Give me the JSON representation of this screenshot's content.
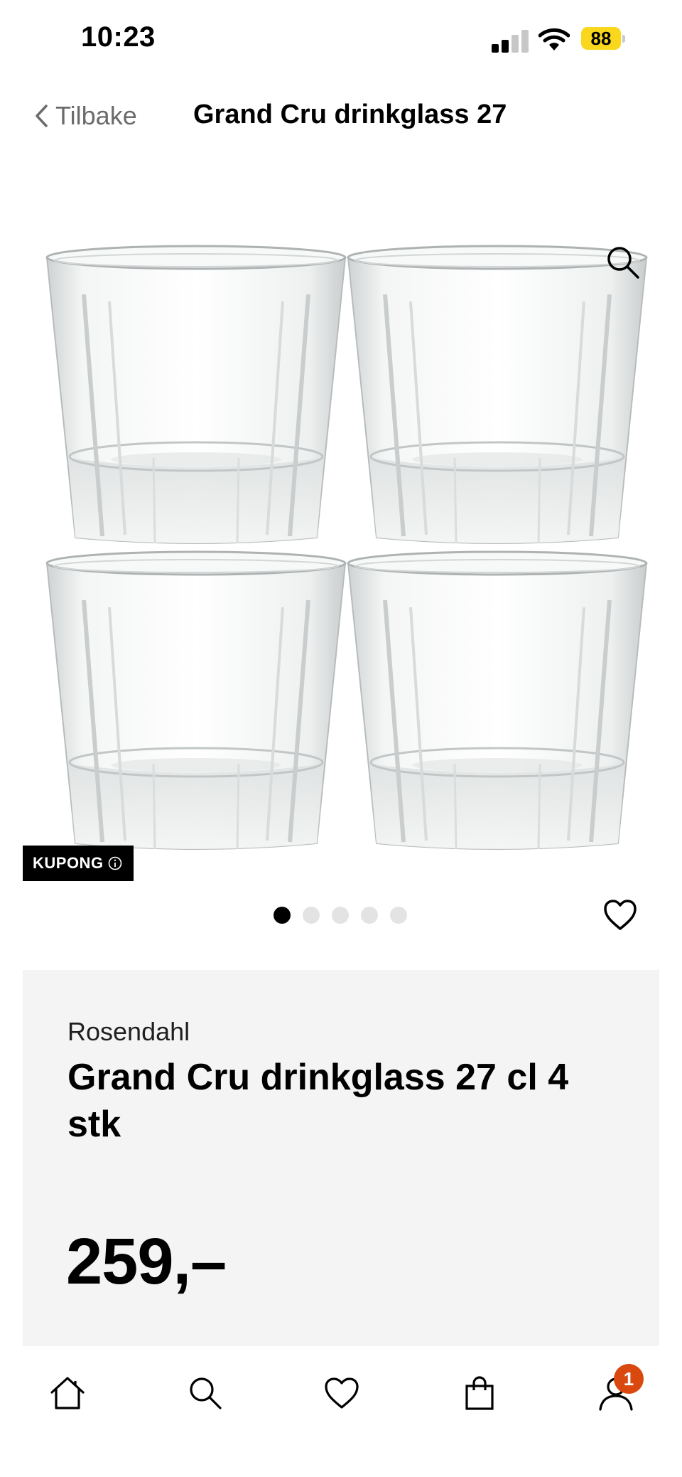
{
  "status_bar": {
    "time": "10:23",
    "battery": "88"
  },
  "nav": {
    "back_label": "Tilbake",
    "title": "Grand Cru drinkglass 27"
  },
  "gallery": {
    "coupon_label": "KUPONG",
    "slide_count": 5,
    "active_slide": 1
  },
  "product": {
    "brand": "Rosendahl",
    "title": "Grand Cru drinkglass 27 cl 4 stk",
    "price": "259,–"
  },
  "tabbar": {
    "items": [
      "home-icon",
      "search-icon",
      "heart-icon",
      "shopping-bag-icon",
      "profile-icon"
    ],
    "cart_badge": "1"
  },
  "colors": {
    "accent_badge": "#d9480f",
    "battery": "#f9d71c",
    "card_bg": "#f5f4f4"
  }
}
